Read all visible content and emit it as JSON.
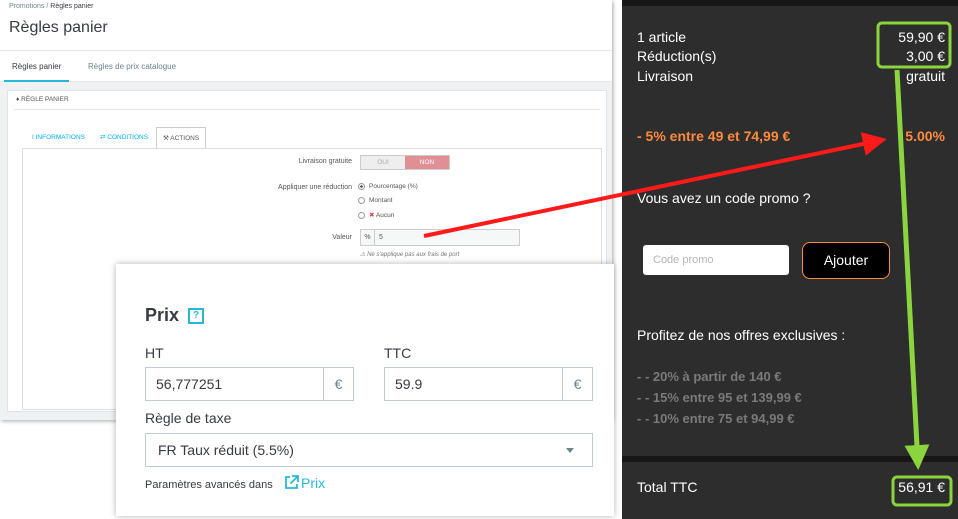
{
  "admin": {
    "breadcrumb": {
      "parent": "Promotions",
      "separator": "/",
      "current": "Règles panier"
    },
    "page_title": "Règles panier",
    "tabs": [
      {
        "label": "Règles panier"
      },
      {
        "label": "Règles de prix catalogue"
      }
    ],
    "card_title": "RÈGLE PANIER",
    "inner_tabs": [
      {
        "label": "INFORMATIONS"
      },
      {
        "label": "CONDITIONS"
      },
      {
        "label": "ACTIONS"
      }
    ],
    "free_shipping": {
      "label": "Livraison gratuite",
      "off": "OUI",
      "on": "NON"
    },
    "apply_discount": {
      "label": "Appliquer une réduction",
      "options": [
        {
          "label": "Pourcentage (%)"
        },
        {
          "label": "Montant"
        },
        {
          "label": "Aucun"
        }
      ]
    },
    "value": {
      "label": "Valeur",
      "prefix": "%",
      "value": "5",
      "note": "Ne s'applique pas aux frais de port"
    }
  },
  "price_card": {
    "title": "Prix",
    "help_icon": "?",
    "ht_label": "HT",
    "ht_value": "56,777251",
    "ttc_label": "TTC",
    "ttc_value": "59.9",
    "currency": "€",
    "tax_rule_label": "Règle de taxe",
    "tax_rule_value": "FR Taux réduit (5.5%)",
    "advanced_text": "Paramètres avancés dans",
    "advanced_link": "Prix"
  },
  "cart": {
    "lines": [
      {
        "label": "1 article",
        "value": "59,90 €"
      },
      {
        "label": "Réduction(s)",
        "value": "3,00 €"
      },
      {
        "label": "Livraison",
        "value": "gratuit"
      }
    ],
    "promo_line": "- 5% entre 49 et 74,99 €",
    "promo_value": "5.00%",
    "promo_question": "Vous avez un code promo ?",
    "code_placeholder": "Code promo",
    "add_button": "Ajouter",
    "offers_title": "Profitez de nos offres exclusives :",
    "offers": [
      {
        "label": "- - 20% à partir de 140 €"
      },
      {
        "label": "- - 15% entre 95 et 139,99 €"
      },
      {
        "label": "- - 10% entre 75 et 94,99 €"
      }
    ],
    "total_label": "Total TTC",
    "total_value": "56,91 €"
  },
  "colors": {
    "accent_blue": "#25b9d7",
    "promo_orange": "#ff8a3d",
    "arrow_red": "#ff1a1a",
    "highlight_green": "#8bd43e"
  }
}
